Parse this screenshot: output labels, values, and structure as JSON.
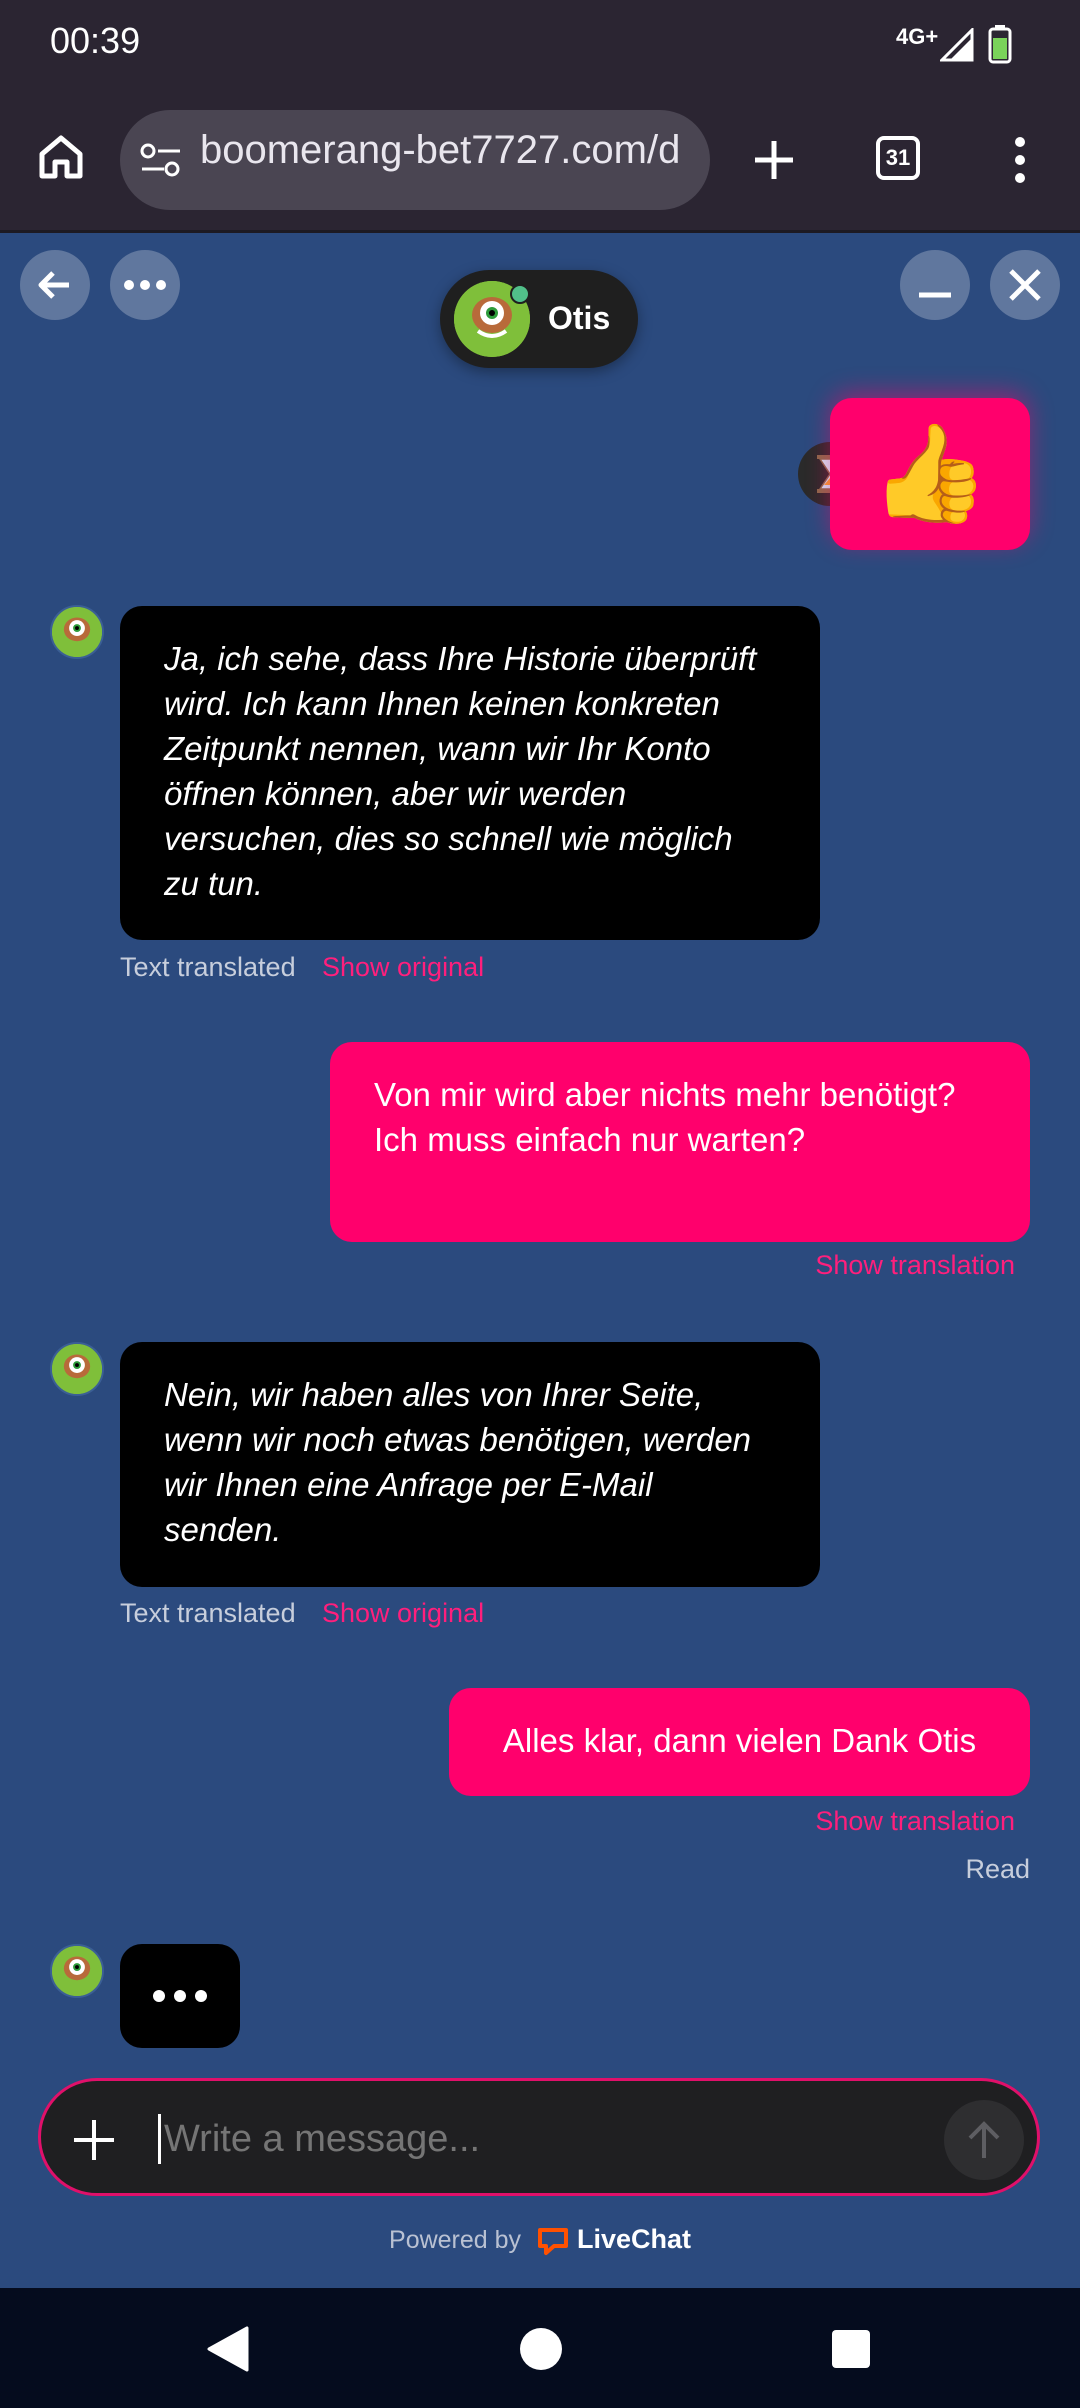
{
  "status": {
    "time": "00:39",
    "network": "4G+"
  },
  "browser": {
    "url": "boomerang-bet7727.com/d",
    "tab_count": "31"
  },
  "chat": {
    "agent_name": "Otis",
    "messages": [
      {
        "from": "user",
        "type": "emoji",
        "text": "👍"
      },
      {
        "from": "agent",
        "text": "Ja, ich sehe, dass Ihre Historie überprüft wird. Ich kann Ihnen keinen konkreten Zeitpunkt nennen, wann wir Ihr Konto öffnen können, aber wir werden versuchen, dies so schnell wie möglich zu tun.",
        "meta_label": "Text translated",
        "link_label": "Show original"
      },
      {
        "from": "user",
        "text": "Von mir wird aber nichts mehr benötigt? Ich muss einfach nur warten?",
        "link_label": "Show translation"
      },
      {
        "from": "agent",
        "text": "Nein, wir haben alles von Ihrer Seite, wenn wir noch etwas benötigen, werden wir Ihnen eine Anfrage per E-Mail senden.",
        "meta_label": "Text translated",
        "link_label": "Show original"
      },
      {
        "from": "user",
        "text": "Alles klar, dann vielen Dank Otis",
        "link_label": "Show translation",
        "status": "Read"
      }
    ],
    "composer": {
      "placeholder": "Write a message..."
    },
    "powered_by": "Powered by",
    "brand": "LiveChat"
  },
  "colors": {
    "background": "#2b4a7e",
    "user_bubble": "#ff006c",
    "agent_bubble": "#000000",
    "link": "#ff1f7c"
  }
}
